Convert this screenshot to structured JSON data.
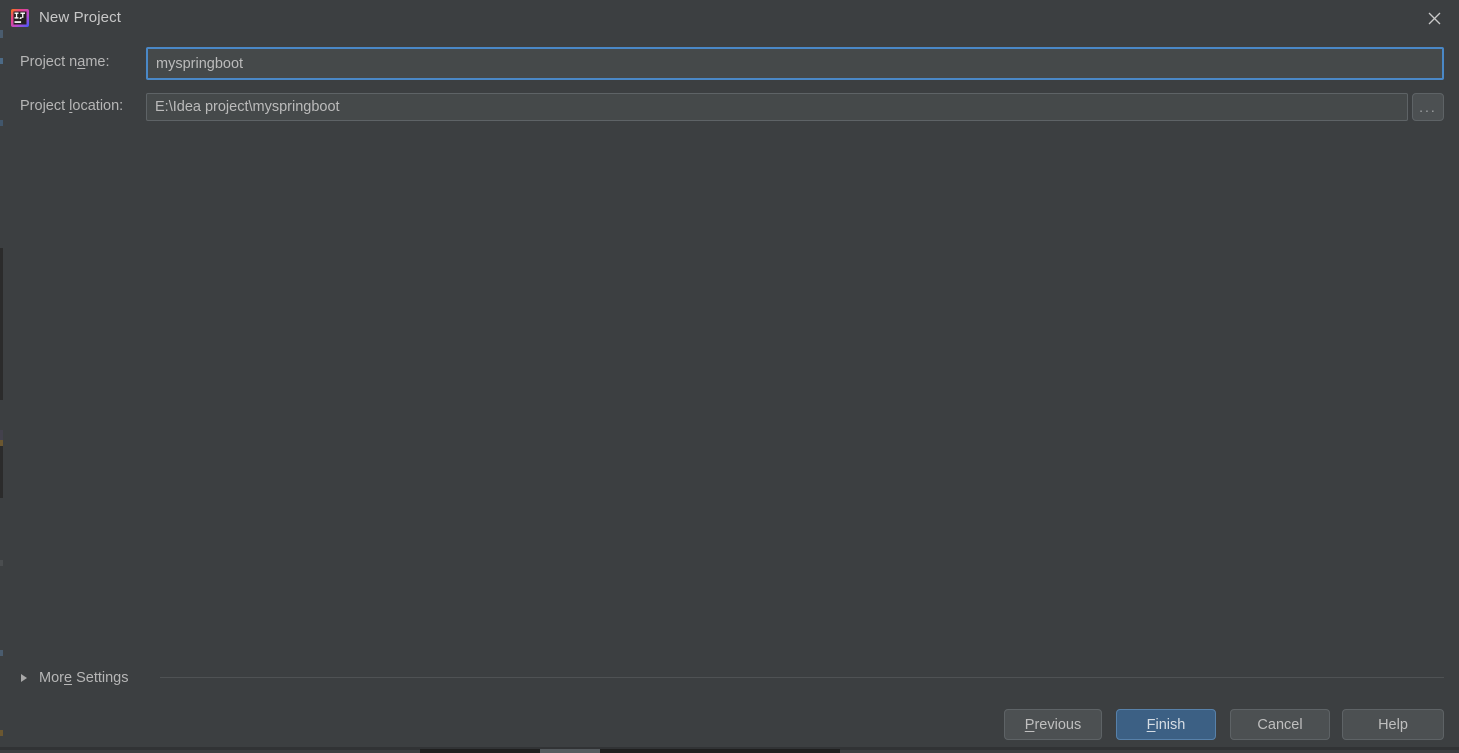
{
  "window": {
    "title": "New Project",
    "app_icon": "intellij-idea-icon",
    "close_icon": "close-icon",
    "background_color": "#3c3f41"
  },
  "form": {
    "project_name": {
      "label_prefix": "Project n",
      "label_mnemonic": "a",
      "label_suffix": "me:",
      "label_full": "Project name:",
      "value": "myspringboot",
      "placeholder": "",
      "focused": true,
      "focus_border_color": "#4a88c7"
    },
    "project_location": {
      "label_prefix": "Project ",
      "label_mnemonic": "l",
      "label_suffix": "ocation:",
      "label_full": "Project location:",
      "value": "E:\\Idea project\\myspringboot",
      "placeholder": "",
      "focused": false,
      "browse_button": {
        "label": "...",
        "icon": "ellipsis-icon"
      }
    }
  },
  "more_settings": {
    "label_prefix": "Mor",
    "label_mnemonic": "e",
    "label_suffix": " Settings",
    "label_full": "More Settings",
    "expanded": false,
    "chevron_icon": "triangle-right-icon"
  },
  "footer": {
    "buttons": [
      {
        "id": "previous",
        "prefix": "",
        "mnemonic": "P",
        "suffix": "revious",
        "label": "Previous",
        "primary": false
      },
      {
        "id": "finish",
        "prefix": "",
        "mnemonic": "F",
        "suffix": "inish",
        "label": "Finish",
        "primary": true,
        "color": "#3c6084"
      },
      {
        "id": "cancel",
        "prefix": "Cancel",
        "mnemonic": "",
        "suffix": "",
        "label": "Cancel",
        "primary": false
      },
      {
        "id": "help",
        "prefix": "Help",
        "mnemonic": "",
        "suffix": "",
        "label": "Help",
        "primary": false
      }
    ]
  }
}
